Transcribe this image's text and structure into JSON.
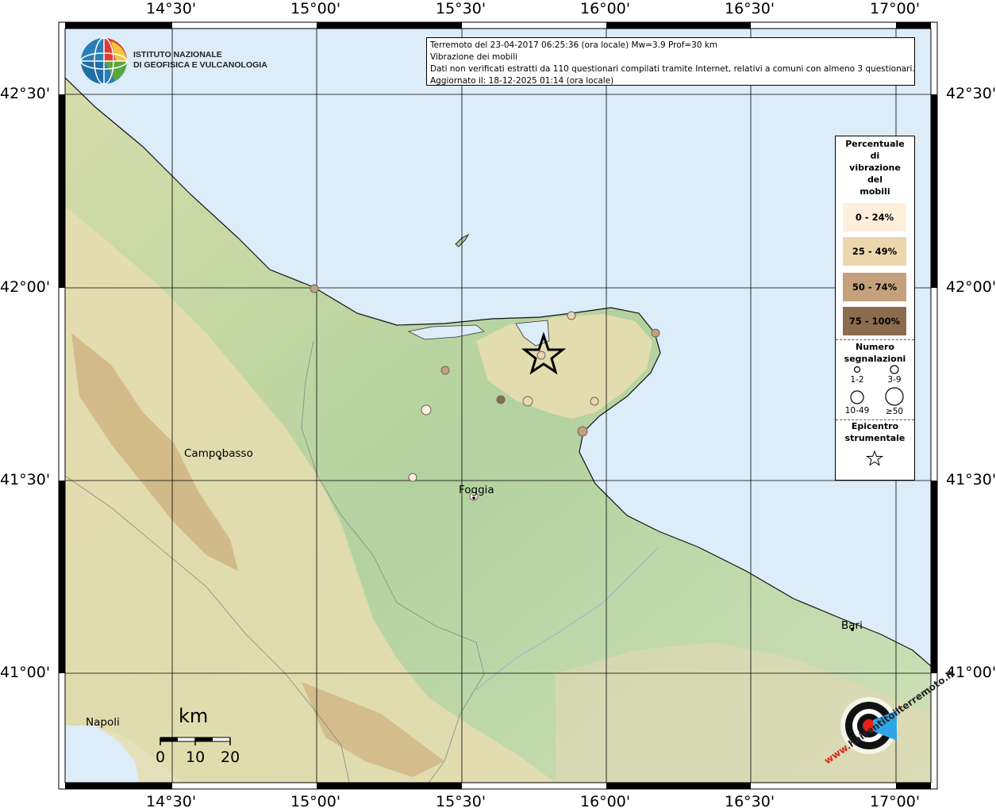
{
  "header": {
    "line1": "Terremoto del 23-04-2017 06:25:36 (ora locale) Mw=3.9 Prof=30 km",
    "line2": "Vibrazione dei mobili",
    "line3": "Dati non verificati estratti da 110 questionari compilati tramite Internet, relativi a comuni con almeno 3 questionari.",
    "line4": "Aggiornato il: 18-12-2025 01:14 (ora locale)"
  },
  "logo_ingv": {
    "line1": "ISTITUTO NAZIONALE",
    "line2": "DI GEOFISICA E VULCANOLOGIA"
  },
  "logo_hsit": {
    "text_main": "haisentitoilterremoto.it",
    "text_www": "www."
  },
  "axes": {
    "top_lon": [
      "14°30'",
      "15°00'",
      "15°30'",
      "16°00'",
      "16°30'",
      "17°00'"
    ],
    "bottom_lon": [
      "14°30'",
      "15°00'",
      "15°30'",
      "16°00'",
      "16°30'",
      "17°00'"
    ],
    "left_lat": [
      "42°30'",
      "42°00'",
      "41°30'",
      "41°00'"
    ],
    "right_lat": [
      "42°30'",
      "42°00'",
      "41°30'",
      "41°00'"
    ]
  },
  "cities": [
    {
      "name": "Campobasso"
    },
    {
      "name": "Foggia"
    },
    {
      "name": "Bari"
    },
    {
      "name": "Napoli"
    }
  ],
  "legend": {
    "title": [
      "Percentuale",
      "di",
      "vibrazione",
      "del",
      "mobili"
    ],
    "classes": [
      {
        "label": "0 - 24%",
        "color": "#fdefdc"
      },
      {
        "label": "25 - 49%",
        "color": "#ecd6ad"
      },
      {
        "label": "50 - 74%",
        "color": "#c4a07b"
      },
      {
        "label": "75 - 100%",
        "color": "#8c6c4e"
      }
    ],
    "count_title": [
      "Numero",
      "segnalazioni"
    ],
    "count_labels": [
      "1-2",
      "3-9",
      "10-49",
      "≥50"
    ],
    "epicenter_title": [
      "Epicentro",
      "strumentale"
    ]
  },
  "scale_bar": {
    "unit": "km",
    "ticks": [
      "0",
      "10",
      "20"
    ]
  },
  "colors": {
    "sea": "#dcecf8",
    "lowland": "#a5cd9a",
    "hills": "#e8ddb0",
    "mountains": "#c59e6c",
    "grid": "#000000"
  },
  "observations": [
    {
      "pct_class": 0,
      "count_class": 1
    },
    {
      "pct_class": 1,
      "count_class": 0
    },
    {
      "pct_class": 2,
      "count_class": 0
    },
    {
      "pct_class": 3,
      "count_class": 0
    },
    {
      "pct_class": 1,
      "count_class": 1
    },
    {
      "pct_class": 1,
      "count_class": 0
    },
    {
      "pct_class": 2,
      "count_class": 1
    },
    {
      "pct_class": 1,
      "count_class": 0
    },
    {
      "pct_class": 2,
      "count_class": 0
    },
    {
      "pct_class": 2,
      "count_class": 0
    },
    {
      "pct_class": 0,
      "count_class": 0
    },
    {
      "pct_class": 1,
      "count_class": 0
    }
  ]
}
